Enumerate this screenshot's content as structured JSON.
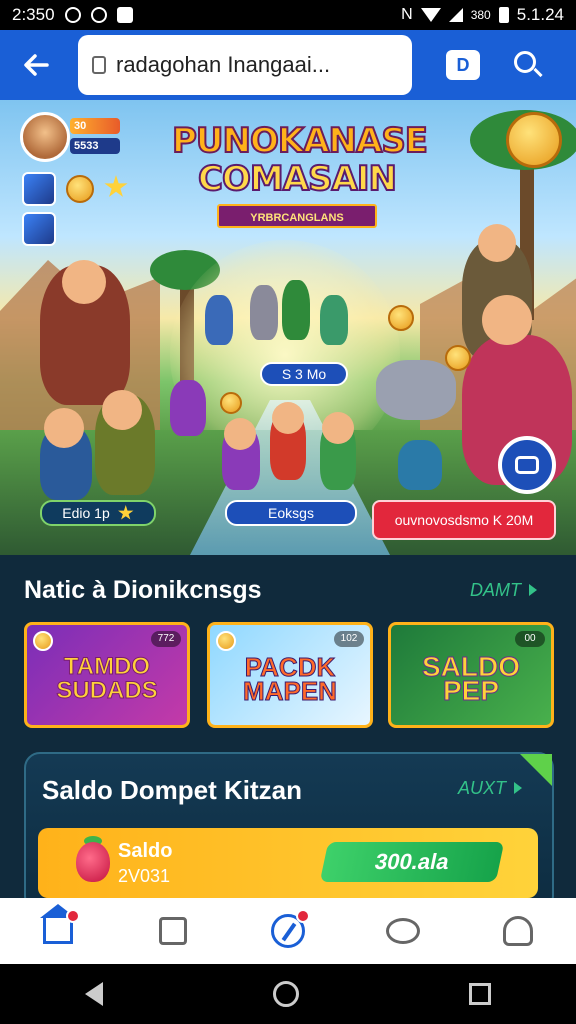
{
  "status_bar": {
    "time": "2:350",
    "right_text": "380",
    "battery_text": "5.1.24"
  },
  "browser": {
    "url": "radagohan Inangaai...",
    "tab_label": "D"
  },
  "hero": {
    "logo_line1": "PUNOKANASE",
    "logo_line2": "COMASAIN",
    "logo_ribbon": "YRBRCANGLANS",
    "player_level": "30",
    "player_coins": "5533",
    "mid_pill": "S 3 Mo",
    "btn_left": "Edio 1p",
    "btn_center": "Eoksgs",
    "btn_right": "ouvnovosdsmo K 20M"
  },
  "games_section": {
    "title": "Natic à Dionikcnsgs",
    "more": "DAMT",
    "cards": [
      {
        "title": "TAMDO SUDADS",
        "badge": "772"
      },
      {
        "title": "PACDK MAPEN",
        "badge": "102"
      },
      {
        "title": "SALDO PEP",
        "badge": "00"
      }
    ]
  },
  "wallet": {
    "title": "Saldo Dompet Kitzan",
    "more": "AUXT",
    "balance_label": "Saldo",
    "balance_sub": "2V031",
    "balance_value": "300.ala"
  },
  "colors": {
    "toolbar_blue": "#1a5fd6",
    "accent_green": "#33c289",
    "gold": "#ffb21a",
    "red": "#e2273c"
  }
}
